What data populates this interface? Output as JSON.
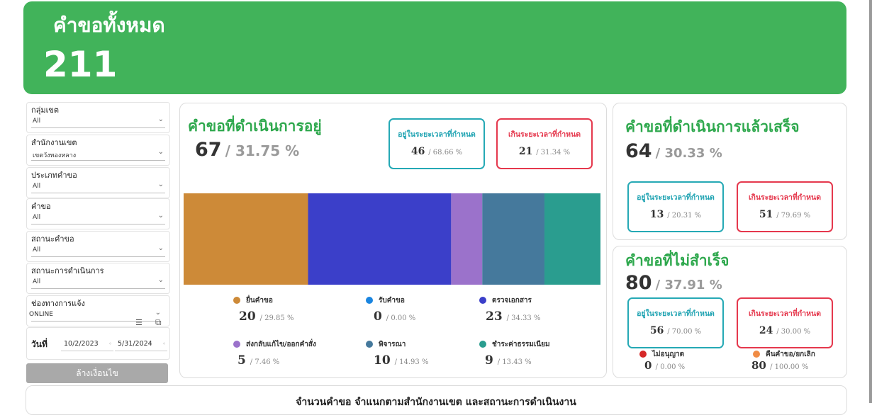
{
  "header": {
    "title": "คำขอทั้งหมด",
    "total": "211",
    "color": "#41b35a"
  },
  "filters": [
    {
      "label": "กลุ่มเขต",
      "value": "All"
    },
    {
      "label": "สำนักงานเขต",
      "value": "เขตวังทองหลาง"
    },
    {
      "label": "ประเภทคำขอ",
      "value": "All"
    },
    {
      "label": "คำขอ",
      "value": "All"
    },
    {
      "label": "สถานะคำขอ",
      "value": "All"
    },
    {
      "label": "สถานะการดำเนินการ",
      "value": "All"
    },
    {
      "label": "ช่องทางการแจ้ง",
      "value": "ONLINE"
    }
  ],
  "date_filter": {
    "label": "วันที่",
    "start": "10/2/2023",
    "end": "5/31/2024"
  },
  "clear_button": "ล้างเงื่อนไข",
  "in_progress": {
    "title": "คำขอที่ดำเนินการอยู่",
    "count": "67",
    "pct": "/ 31.75 %",
    "on_time": {
      "label": "อยู่ในระยะเวลาที่กำหนด",
      "count": "46",
      "pct": "/ 68.66 %"
    },
    "overdue": {
      "label": "เกินระยะเวลาที่กำหนด",
      "count": "21",
      "pct": "/ 31.34 %"
    },
    "legend": [
      {
        "name": "ยื่นคำขอ",
        "count": "20",
        "pct": "/ 29.85 %",
        "color": "#cd8a38"
      },
      {
        "name": "รับคำขอ",
        "count": "0",
        "pct": "/ 0.00 %",
        "color": "#1a85e0"
      },
      {
        "name": "ตรวจเอกสาร",
        "count": "23",
        "pct": "/ 34.33 %",
        "color": "#3b3fc9"
      },
      {
        "name": "ส่งกลับแก้ไข/ออกคำสั่ง",
        "count": "5",
        "pct": "/ 7.46 %",
        "color": "#9b72cb"
      },
      {
        "name": "พิจารณา",
        "count": "10",
        "pct": "/ 14.93 %",
        "color": "#45799c"
      },
      {
        "name": "ชำระค่าธรรมเนียม",
        "count": "9",
        "pct": "/ 13.43 %",
        "color": "#2a9d8f"
      }
    ]
  },
  "chart_data": {
    "type": "bar",
    "stacked": "horizontal-100%",
    "series": [
      {
        "name": "ยื่นคำขอ",
        "value": 20,
        "color": "#cd8a38"
      },
      {
        "name": "รับคำขอ",
        "value": 0,
        "color": "#1a85e0"
      },
      {
        "name": "ตรวจเอกสาร",
        "value": 23,
        "color": "#3b3fc9"
      },
      {
        "name": "ส่งกลับแก้ไข/ออกคำสั่ง",
        "value": 5,
        "color": "#9b72cb"
      },
      {
        "name": "พิจารณา",
        "value": 10,
        "color": "#45799c"
      },
      {
        "name": "ชำระค่าธรรมเนียม",
        "value": 9,
        "color": "#2a9d8f"
      }
    ]
  },
  "completed": {
    "title": "คำขอที่ดำเนินการแล้วเสร็จ",
    "count": "64",
    "pct": "/ 30.33 %",
    "on_time": {
      "label": "อยู่ในระยะเวลาที่กำหนด",
      "count": "13",
      "pct": "/ 20.31 %"
    },
    "overdue": {
      "label": "เกินระยะเวลาที่กำหนด",
      "count": "51",
      "pct": "/ 79.69 %"
    }
  },
  "failed": {
    "title": "คำขอที่ไม่สำเร็จ",
    "count": "80",
    "pct": "/ 37.91 %",
    "on_time": {
      "label": "อยู่ในระยะเวลาที่กำหนด",
      "count": "56",
      "pct": "/ 70.00 %"
    },
    "overdue": {
      "label": "เกินระยะเวลาที่กำหนด",
      "count": "24",
      "pct": "/ 30.00 %"
    },
    "legend": [
      {
        "name": "ไม่อนุญาต",
        "count": "0",
        "pct": "/ 0.00 %",
        "color": "#d62828"
      },
      {
        "name": "คืนคำขอ/ยกเลิก",
        "count": "80",
        "pct": "/ 100.00 %",
        "color": "#f08c45"
      }
    ]
  },
  "bottom": {
    "title": "จำนวนคำขอ จำแนกตามสำนักงานเขต และสถานะการดำเนินงาน"
  }
}
